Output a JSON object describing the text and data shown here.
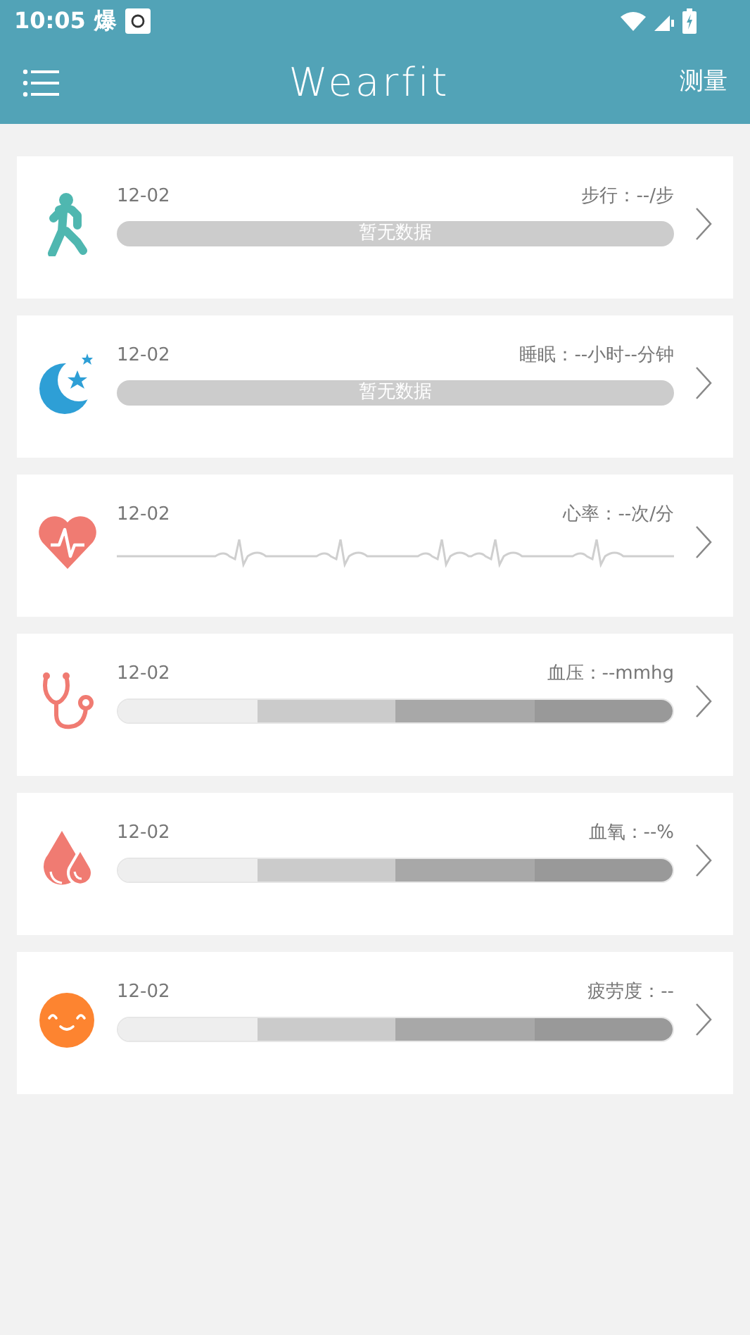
{
  "status_bar": {
    "time": "10:05",
    "app_char": "爆"
  },
  "header": {
    "title": "Wearfit",
    "action": "测量"
  },
  "cards": [
    {
      "kind": "bar",
      "date": "12-02",
      "reading": "步行：--/步",
      "bar_text": "暂无数据"
    },
    {
      "kind": "bar",
      "date": "12-02",
      "reading": "睡眠：--小时--分钟",
      "bar_text": "暂无数据"
    },
    {
      "kind": "ecg",
      "date": "12-02",
      "reading": "心率：--次/分"
    },
    {
      "kind": "segments",
      "date": "12-02",
      "reading": "血压：--mmhg"
    },
    {
      "kind": "segments",
      "date": "12-02",
      "reading": "血氧：--%"
    },
    {
      "kind": "segments",
      "date": "12-02",
      "reading": "疲劳度：--"
    }
  ]
}
